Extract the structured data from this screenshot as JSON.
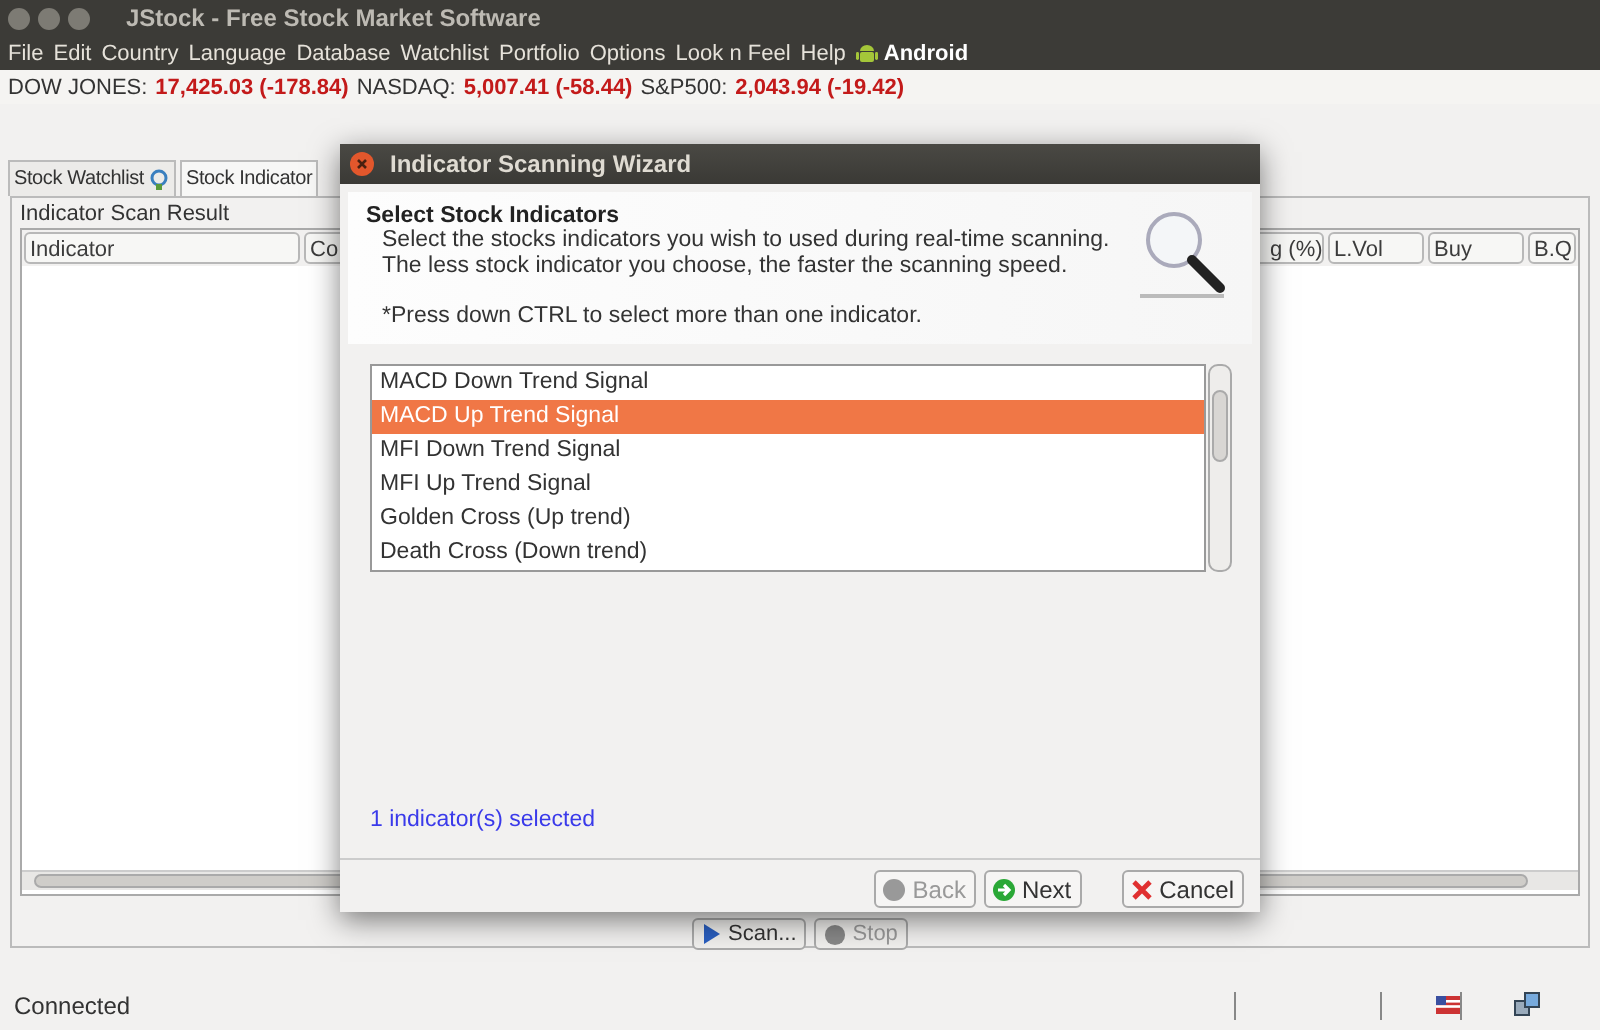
{
  "window": {
    "title": "JStock - Free Stock Market Software"
  },
  "menu": [
    {
      "label": "File"
    },
    {
      "label": "Edit"
    },
    {
      "label": "Country"
    },
    {
      "label": "Language"
    },
    {
      "label": "Database"
    },
    {
      "label": "Watchlist"
    },
    {
      "label": "Portfolio"
    },
    {
      "label": "Options"
    },
    {
      "label": "Look n Feel"
    },
    {
      "label": "Help"
    },
    {
      "label": "Android",
      "kind": "android"
    }
  ],
  "ticker": [
    {
      "name": "DOW JONES:",
      "value": "17,425.03 (-178.84)"
    },
    {
      "name": "NASDAQ:",
      "value": "5,007.41 (-58.44)"
    },
    {
      "name": "S&P500:",
      "value": "2,043.94 (-19.42)"
    }
  ],
  "tabs": [
    {
      "label": "Stock Watchlist",
      "selected": false
    },
    {
      "label": "Stock Indicator",
      "selected": true
    }
  ],
  "scan_result": {
    "title": "Indicator Scan Result",
    "columns": [
      "Indicator",
      "Co",
      "g (%)",
      "L.Vol",
      "Buy",
      "B.Q"
    ],
    "buttons": [
      {
        "label": "Scan...",
        "kind": "scan",
        "disabled": false
      },
      {
        "label": "Stop",
        "kind": "stop",
        "disabled": true
      }
    ]
  },
  "status_bar": {
    "text": "Connected"
  },
  "dialog": {
    "title": "Indicator Scanning Wizard",
    "heading": "Select Stock Indicators",
    "description": "Select the stocks indicators you wish to used during real-time scanning. The less stock indicator you choose, the faster the scanning speed.",
    "note": "*Press down CTRL to select more than one indicator.",
    "indicators": [
      {
        "label": "MACD Down Trend Signal",
        "selected": false
      },
      {
        "label": "MACD Up Trend Signal",
        "selected": true
      },
      {
        "label": "MFI Down Trend Signal",
        "selected": false
      },
      {
        "label": "MFI Up Trend Signal",
        "selected": false
      },
      {
        "label": "Golden Cross (Up trend)",
        "selected": false
      },
      {
        "label": "Death Cross (Down trend)",
        "selected": false
      }
    ],
    "selection_count": "1 indicator(s) selected",
    "buttons": [
      {
        "label": "Back",
        "kind": "back",
        "disabled": true
      },
      {
        "label": "Next",
        "kind": "next",
        "disabled": false
      },
      {
        "label": "Cancel",
        "kind": "cancel",
        "disabled": false
      }
    ]
  }
}
